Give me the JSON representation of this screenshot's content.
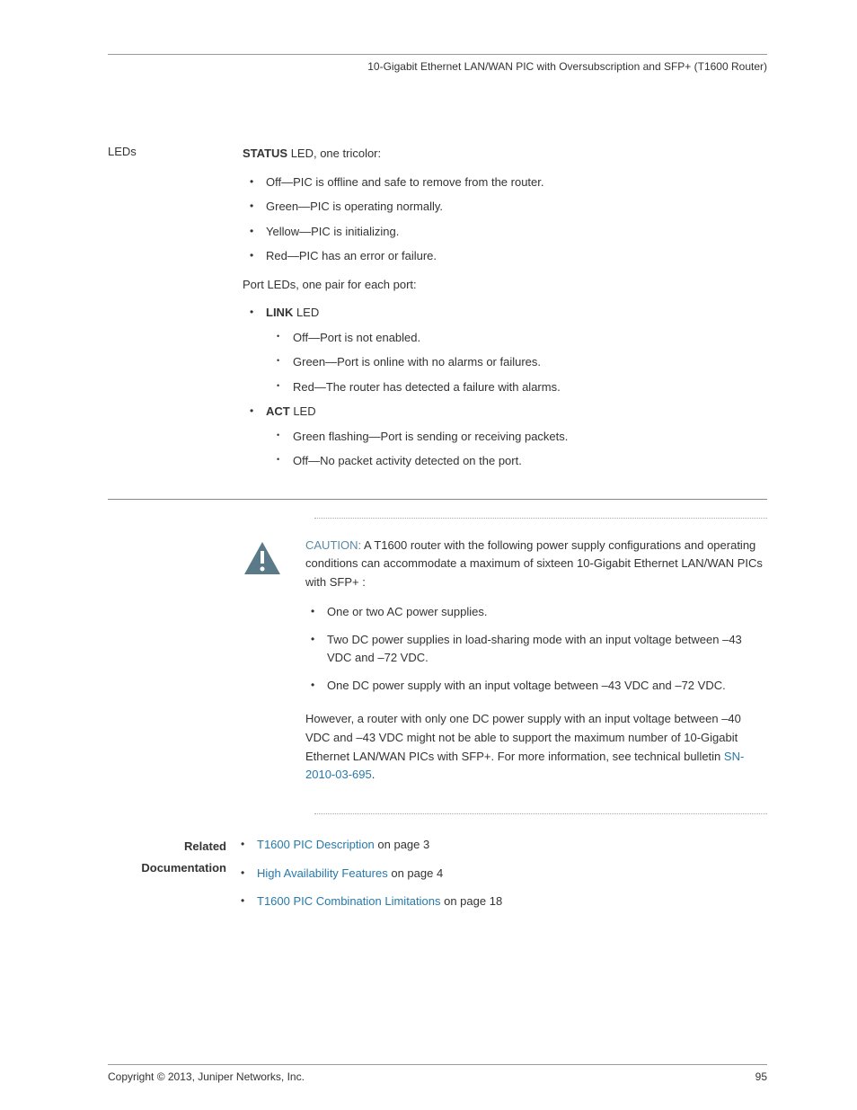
{
  "header": {
    "title": "10-Gigabit Ethernet LAN/WAN PIC with Oversubscription and SFP+ (T1600 Router)"
  },
  "leds": {
    "label": "LEDs",
    "status_prefix": "STATUS",
    "status_suffix": " LED, one tricolor:",
    "status_items": {
      "off": "Off—PIC is offline and safe to remove from the router.",
      "green": "Green—PIC is operating normally.",
      "yellow": "Yellow—PIC is initializing.",
      "red": "Red—PIC has an error or failure."
    },
    "port_intro": "Port LEDs, one pair for each port:",
    "link_prefix": "LINK",
    "link_suffix": " LED",
    "link_items": {
      "off": "Off—Port is not enabled.",
      "green": "Green—Port is online with no alarms or failures.",
      "red": "Red—The router has detected a failure with alarms."
    },
    "act_prefix": "ACT",
    "act_suffix": " LED",
    "act_items": {
      "green": "Green flashing—Port is sending or receiving packets.",
      "off": "Off—No packet activity detected on the port."
    }
  },
  "caution": {
    "label": "CAUTION:",
    "intro": "  A T1600 router with the following power supply configurations and operating conditions can accommodate a maximum of sixteen 10-Gigabit Ethernet LAN/WAN PICs with SFP+ :",
    "items": {
      "ac": "One or two AC power supplies.",
      "dc2": "Two DC power supplies in load-sharing mode with an input voltage between –43 VDC and –72 VDC.",
      "dc1": "One DC power supply with an input voltage between –43 VDC and –72 VDC."
    },
    "footer_pre": "However, a router with only one DC power supply with an input voltage between –40 VDC and –43 VDC might not be able to support the maximum number of 10-Gigabit Ethernet LAN/WAN PICs with SFP+. For more information, see technical bulletin ",
    "bulletin": "SN-2010-03-695",
    "footer_post": "."
  },
  "related": {
    "label": "Related Documentation",
    "items": {
      "desc_link": "T1600 PIC Description",
      "desc_suffix": " on page 3",
      "ha_link": "High Availability Features",
      "ha_suffix": " on page 4",
      "limits_link": "T1600 PIC Combination Limitations",
      "limits_suffix": " on page 18"
    }
  },
  "footer": {
    "copyright": "Copyright © 2013, Juniper Networks, Inc.",
    "page": "95"
  }
}
